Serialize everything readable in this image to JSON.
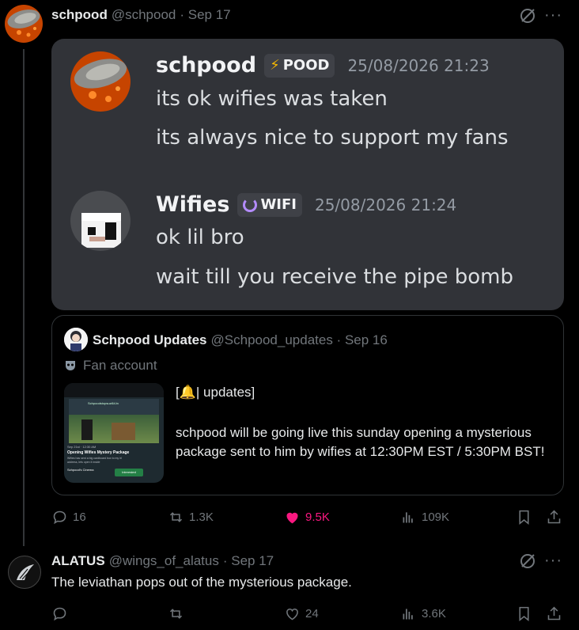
{
  "post": {
    "display_name": "schpood",
    "handle": "@schpood",
    "date": "· Sep 17",
    "more": "···",
    "discord": {
      "msg1": {
        "name": "schpood",
        "tag": "POOD",
        "time": "25/08/2026 21:23",
        "line1": "its ok wifies was taken",
        "line2": "its always nice to support my fans"
      },
      "msg2": {
        "name": "Wifies",
        "tag": "WIFI",
        "time": "25/08/2026 21:24",
        "line1": "ok lil bro",
        "line2": "wait till you receive the pipe bomb"
      }
    },
    "quote": {
      "display_name": "Schpood Updates",
      "handle": "@Schpood_updates · Sep 16",
      "label": "Fan account",
      "text_heading": "[🔔| updates]",
      "text_body": "schpood will be going live this sunday opening a mysterious package sent to him by wifies at 12:30PM EST / 5:30PM BST!",
      "thumb": {
        "title": "Schpoodstopsuzi64.tv",
        "event_time": "Sep 21st · 12:30 AM",
        "event_title": "Opening Wifies Mystery Package",
        "event_desc": "Wifies has sent a big cardboard box to my irl address, lets open it inside",
        "server": "Schpood's Cinema",
        "button": "Interested"
      }
    },
    "actions": {
      "replies": "16",
      "reposts": "1.3K",
      "likes": "9.5K",
      "views": "109K"
    }
  },
  "reply": {
    "display_name": "ALATUS",
    "handle": "@wings_of_alatus",
    "date": "· Sep 17",
    "more": "···",
    "text": "The leviathan pops out of the mysterious package.",
    "actions": {
      "replies": "",
      "reposts": "",
      "likes": "24",
      "views": "3.6K"
    }
  },
  "colors": {
    "accent_like": "#f91880",
    "muted": "#71767b",
    "discord_bg": "#313338"
  }
}
